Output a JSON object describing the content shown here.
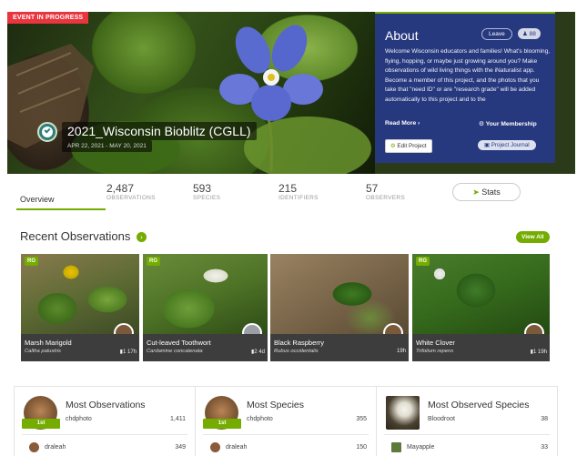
{
  "hero": {
    "event_badge": "EVENT IN PROGRESS",
    "project_title": "2021_Wisconsin Bioblitz (CGLL)",
    "dates": "APR 22, 2021 - MAY 20, 2021"
  },
  "about": {
    "title": "About",
    "leave_label": "Leave",
    "member_count": "88",
    "text": "Welcome Wisconsin educators and families! What's blooming, flying, hopping, or maybe just growing around you? Make observations of wild living things with the iNaturalist app. Become a member of this project, and the photos that you take that \"need ID\" or are \"research grade\" will be added automatically to this project and to the",
    "read_more": "Read More ›",
    "membership": "Your Membership",
    "edit_project": "Edit Project",
    "project_journal": "Project Journal"
  },
  "stats": {
    "overview_label": "Overview",
    "observations": {
      "value": "2,487",
      "label": "OBSERVATIONS"
    },
    "species": {
      "value": "593",
      "label": "SPECIES"
    },
    "identifiers": {
      "value": "215",
      "label": "IDENTIFIERS"
    },
    "observers": {
      "value": "57",
      "label": "OBSERVERS"
    },
    "stats_button": "Stats"
  },
  "recent": {
    "title": "Recent Observations",
    "view_all": "View All",
    "cards": [
      {
        "badge": "RG",
        "common": "Marsh Marigold",
        "sci": "Caltha palustris",
        "ids": "1",
        "age": "17h"
      },
      {
        "badge": "RG",
        "common": "Cut-leaved Toothwort",
        "sci": "Cardamine concatenata",
        "ids": "2",
        "age": "4d"
      },
      {
        "badge": "",
        "common": "Black Raspberry",
        "sci": "Rubus occidentalis",
        "ids": "",
        "age": "19h"
      },
      {
        "badge": "RG",
        "common": "White Clover",
        "sci": "Trifolium repens",
        "ids": "1",
        "age": "19h"
      }
    ]
  },
  "boards": [
    {
      "title": "Most Observations",
      "ribbon": "1st",
      "leader": "chdphoto",
      "leader_count": "1,411",
      "second": "draleah",
      "second_count": "349"
    },
    {
      "title": "Most Species",
      "ribbon": "1st",
      "leader": "chdphoto",
      "leader_count": "355",
      "second": "draleah",
      "second_count": "150"
    },
    {
      "title": "Most Observed Species",
      "ribbon": "",
      "leader": "Bloodroot",
      "leader_count": "38",
      "second": "Mayapple",
      "second_count": "33"
    }
  ]
}
